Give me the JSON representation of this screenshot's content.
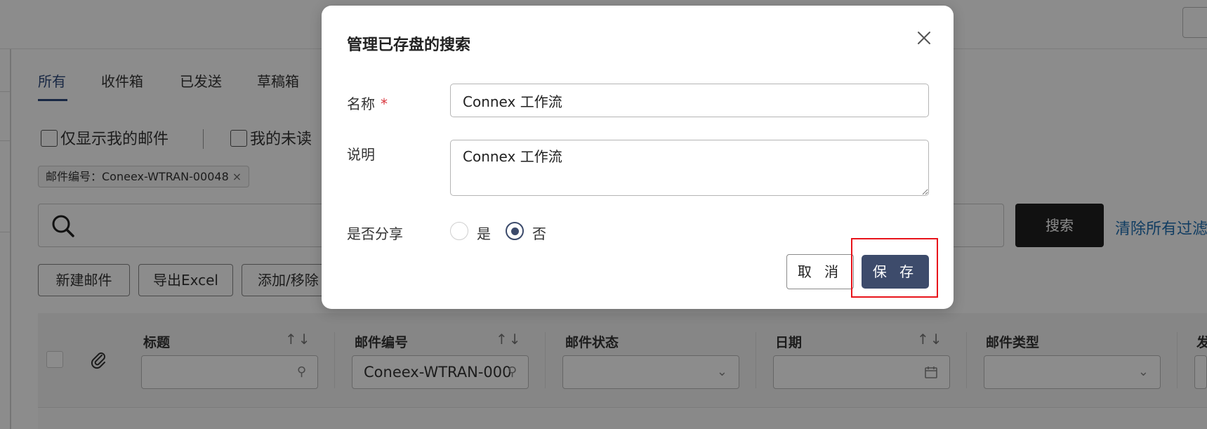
{
  "tabs": [
    "所有",
    "收件箱",
    "已发送",
    "草稿箱"
  ],
  "filters": {
    "only_mine": "仅显示我的邮件",
    "my_unread": "我的未读"
  },
  "filter_tag": "邮件编号：Coneex-WTRAN-00048",
  "filter_tag_close": "×",
  "search": {
    "button": "搜索",
    "clear_link": "清除所有过滤"
  },
  "actions": [
    "新建邮件",
    "导出Excel",
    "添加/移除"
  ],
  "columns": {
    "title": "标题",
    "mail_no": "邮件编号",
    "mail_no_value": "Coneex-WTRAN-000",
    "status": "邮件状态",
    "date": "日期",
    "type": "邮件类型",
    "more": "发"
  },
  "modal": {
    "title": "管理已存盘的搜索",
    "name_label": "名称",
    "required_mark": "*",
    "name_value": "Connex 工作流",
    "desc_label": "说明",
    "desc_value": "Connex 工作流",
    "share_label": "是否分享",
    "share_yes": "是",
    "share_no": "否",
    "share_selected": "否",
    "cancel": "取 消",
    "save": "保 存"
  },
  "colors": {
    "primary": "#3d4b6b",
    "link": "#1f6fb3",
    "highlight": "#e8141b",
    "dark_button": "#1f1f1f"
  }
}
